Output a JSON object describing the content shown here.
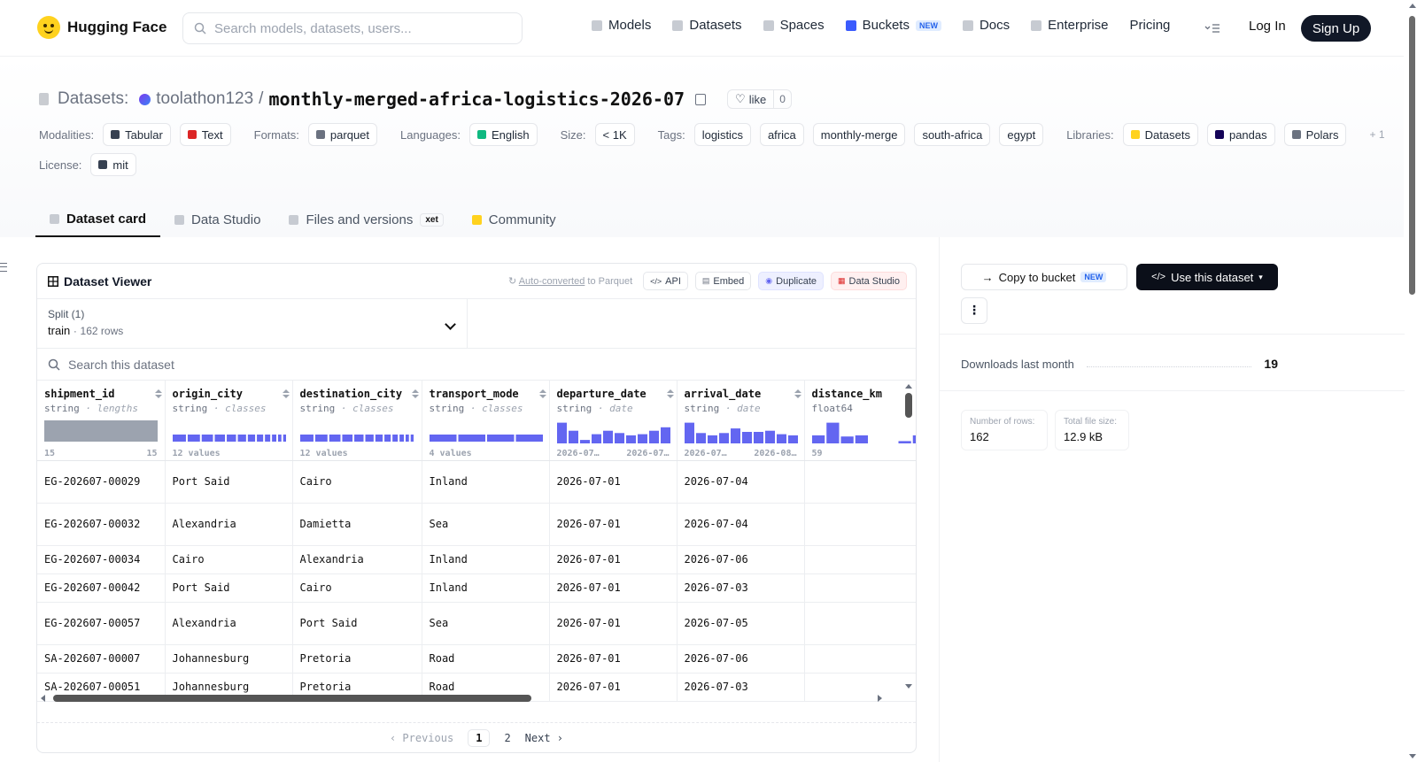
{
  "nav": {
    "brand": "Hugging Face",
    "search_placeholder": "Search models, datasets, users...",
    "links": [
      {
        "label": "Models",
        "icon": "cube-icon"
      },
      {
        "label": "Datasets",
        "icon": "database-icon"
      },
      {
        "label": "Spaces",
        "icon": "grid-icon"
      },
      {
        "label": "Buckets",
        "icon": "bucket-icon",
        "badge": "NEW"
      },
      {
        "label": "Docs",
        "icon": "book-icon"
      },
      {
        "label": "Enterprise",
        "icon": "building-icon"
      },
      {
        "label": "Pricing"
      }
    ],
    "login": "Log In",
    "signup": "Sign Up"
  },
  "header": {
    "section_label": "Datasets:",
    "owner": "toolathon123",
    "separator": "/",
    "dataset_name": "monthly-merged-africa-logistics-2026-07",
    "like_label": "like",
    "like_count": "0",
    "modalities_label": "Modalities:",
    "modalities": [
      "Tabular",
      "Text"
    ],
    "formats_label": "Formats:",
    "formats": [
      "parquet"
    ],
    "languages_label": "Languages:",
    "languages": [
      "English"
    ],
    "size_label": "Size:",
    "size": "< 1K",
    "tags_label": "Tags:",
    "tags": [
      "logistics",
      "africa",
      "monthly-merge",
      "south-africa",
      "egypt"
    ],
    "libraries_label": "Libraries:",
    "libraries": [
      "Datasets",
      "pandas",
      "Polars"
    ],
    "libraries_more": "+ 1",
    "license_label": "License:",
    "license": "mit"
  },
  "tabs": [
    {
      "label": "Dataset card",
      "active": true
    },
    {
      "label": "Data Studio"
    },
    {
      "label": "Files and versions",
      "badge": "xet"
    },
    {
      "label": "Community"
    }
  ],
  "viewer": {
    "title": "Dataset Viewer",
    "auto_link": "Auto-converted",
    "auto_rest": "to Parquet",
    "actions": [
      "API",
      "Embed",
      "Duplicate",
      "Data Studio"
    ],
    "split_label": "Split (1)",
    "split_name": "train",
    "split_sep": "·",
    "split_rows": "162 rows",
    "search_placeholder": "Search this dataset",
    "columns": [
      {
        "name": "shipment_id",
        "type": "string",
        "stat": "lengths",
        "viz": "bar",
        "foot_left": "15",
        "foot_right": "15"
      },
      {
        "name": "origin_city",
        "type": "string",
        "stat": "classes",
        "viz": "classes",
        "segments": 12,
        "foot_left": "12 values"
      },
      {
        "name": "destination_city",
        "type": "string",
        "stat": "classes",
        "viz": "classes",
        "segments": 12,
        "foot_left": "12 values"
      },
      {
        "name": "transport_mode",
        "type": "string",
        "stat": "classes",
        "viz": "classes",
        "segments": 4,
        "foot_left": "4 values"
      },
      {
        "name": "departure_date",
        "type": "string",
        "stat": "date",
        "viz": "hist",
        "bins": [
          0.9,
          0.55,
          0.15,
          0.4,
          0.55,
          0.45,
          0.35,
          0.4,
          0.55,
          0.7
        ],
        "foot_left": "2026-07…",
        "foot_right": "2026-07…"
      },
      {
        "name": "arrival_date",
        "type": "string",
        "stat": "date",
        "viz": "hist",
        "bins": [
          0.9,
          0.45,
          0.35,
          0.45,
          0.65,
          0.5,
          0.5,
          0.55,
          0.4,
          0.35
        ],
        "foot_left": "2026-07…",
        "foot_right": "2026-08…"
      },
      {
        "name": "distance_km",
        "type": "float64",
        "stat": "",
        "viz": "hist",
        "bins": [
          0.35,
          0.9,
          0.3,
          0.35,
          0.0,
          0.0,
          0.1,
          0.35
        ],
        "foot_left": "59",
        "foot_right": ""
      }
    ],
    "rows": [
      [
        "EG-202607-00029",
        "Port Said",
        "Cairo",
        "Inland",
        "2026-07-01",
        "2026-07-04",
        ""
      ],
      [
        "EG-202607-00032",
        "Alexandria",
        "Damietta",
        "Sea",
        "2026-07-01",
        "2026-07-04",
        ""
      ],
      [
        "EG-202607-00034",
        "Cairo",
        "Alexandria",
        "Inland",
        "2026-07-01",
        "2026-07-06",
        ""
      ],
      [
        "EG-202607-00042",
        "Port Said",
        "Cairo",
        "Inland",
        "2026-07-01",
        "2026-07-03",
        ""
      ],
      [
        "EG-202607-00057",
        "Alexandria",
        "Port Said",
        "Sea",
        "2026-07-01",
        "2026-07-05",
        ""
      ],
      [
        "SA-202607-00007",
        "Johannesburg",
        "Pretoria",
        "Road",
        "2026-07-01",
        "2026-07-06",
        ""
      ],
      [
        "SA-202607-00051",
        "Johannesburg",
        "Pretoria",
        "Road",
        "2026-07-01",
        "2026-07-03",
        ""
      ]
    ],
    "pager": {
      "prev": "Previous",
      "pages": [
        "1",
        "2"
      ],
      "current": "1",
      "next": "Next"
    }
  },
  "side": {
    "copy_bucket": "Copy to bucket",
    "copy_badge": "NEW",
    "use_dataset": "Use this dataset",
    "more": "⋮",
    "downloads_label": "Downloads last month",
    "downloads_value": "19",
    "rows_label": "Number of rows:",
    "rows_value": "162",
    "size_label": "Total file size:",
    "size_value": "12.9 kB"
  },
  "colors": {
    "accent": "#6366f1",
    "dark": "#0b0f19",
    "logo": "#ffd21e"
  }
}
